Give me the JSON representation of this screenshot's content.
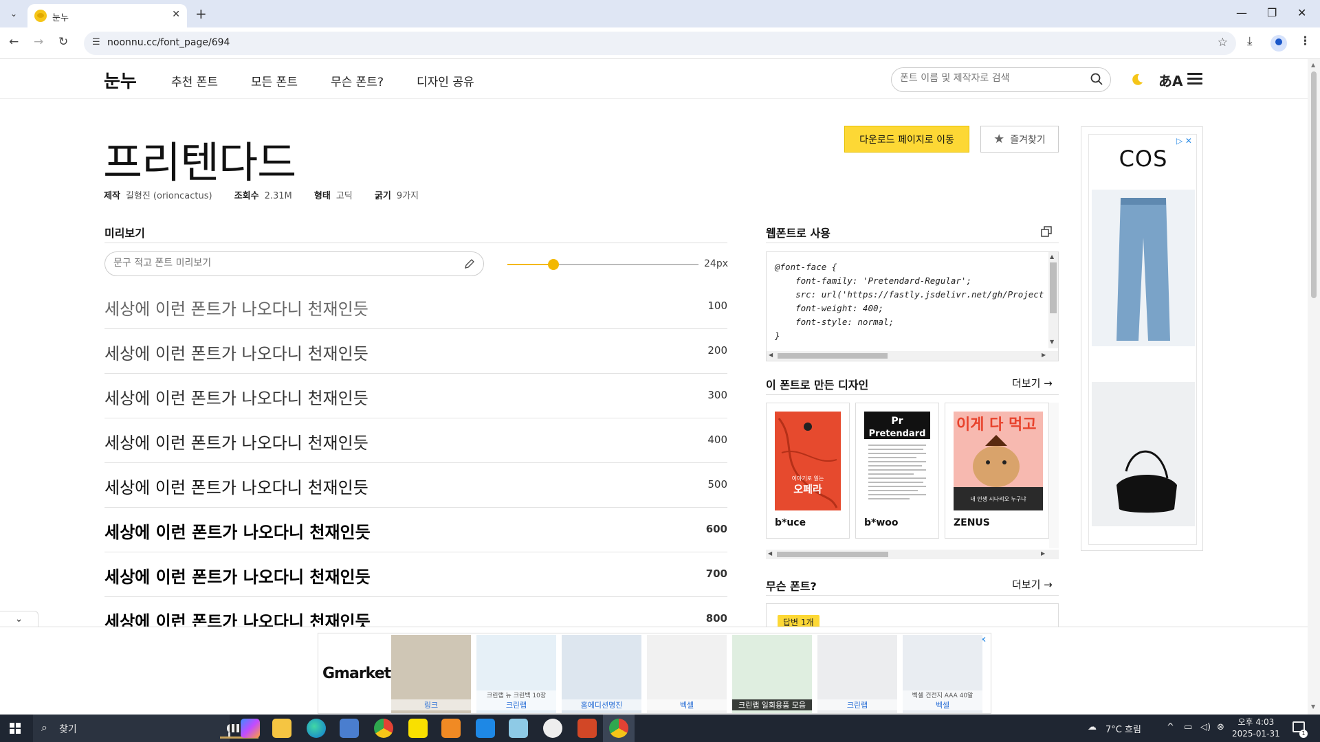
{
  "browser": {
    "tab_title": "눈누",
    "url": "noonnu.cc/font_page/694"
  },
  "site": {
    "logo": "눈누",
    "nav": [
      "추천 폰트",
      "모든 폰트",
      "무슨 폰트?",
      "디자인 공유"
    ],
    "search_placeholder": "폰트 이름 및 제작자로 검색"
  },
  "font": {
    "title": "프리텐다드",
    "meta": [
      {
        "label": "제작",
        "value": "길형진 (orioncactus)"
      },
      {
        "label": "조회수",
        "value": "2.31M"
      },
      {
        "label": "형태",
        "value": "고딕"
      },
      {
        "label": "굵기",
        "value": "9가지"
      }
    ],
    "download_label": "다운로드 페이지로 이동",
    "favorite_label": "즐겨찾기"
  },
  "preview": {
    "section_title": "미리보기",
    "input_placeholder": "문구 적고 폰트 미리보기",
    "size_label": "24px",
    "slider_fraction": 0.24,
    "sample_text": "세상에 이런 폰트가 나오다니 천재인듯",
    "weights": [
      "100",
      "200",
      "300",
      "400",
      "500",
      "600",
      "700",
      "800"
    ]
  },
  "webfont": {
    "section_title": "웹폰트로 사용",
    "code": "@font-face {\n    font-family: 'Pretendard-Regular';\n    src: url('https://fastly.jsdelivr.net/gh/Project\n    font-weight: 400;\n    font-style: normal;\n}"
  },
  "designs": {
    "section_title": "이 폰트로 만든 디자인",
    "more_label": "더보기 →",
    "items": [
      {
        "author": "b*uce",
        "thumb_text": "오페라",
        "thumb_sub": "이야기로 읽는"
      },
      {
        "author": "b*woo",
        "thumb_text": "Pretendard",
        "thumb_sub": "Pr"
      },
      {
        "author": "ZENUS",
        "thumb_text": "이게 다 먹고",
        "thumb_sub": "내 인생 시나리오 누구냐"
      }
    ]
  },
  "whatfont": {
    "section_title": "무슨 폰트?",
    "more_label": "더보기 →",
    "badge": "답변 1개"
  },
  "side_ad": {
    "brand": "COS"
  },
  "bottom_ad": {
    "brand": "Gmarket",
    "products": [
      "링크",
      "크린랩",
      "홈에디션명진",
      "벡셀",
      "크린랩 일회용품 모음",
      "크린랩",
      "벡셀"
    ],
    "product_extra": [
      "",
      "크린랩 뉴 크린백 10장",
      "",
      "",
      "",
      "",
      "벡셀 건전지 AAA 40알"
    ]
  },
  "taskbar": {
    "search_label": "찾기",
    "weather": "7°C  흐림",
    "time": "오후 4:03",
    "date": "2025-01-31",
    "notif_count": "1"
  },
  "colors": {
    "accent": "#fdd835",
    "slider": "#f3b800",
    "taskbar": "#1f2632"
  }
}
